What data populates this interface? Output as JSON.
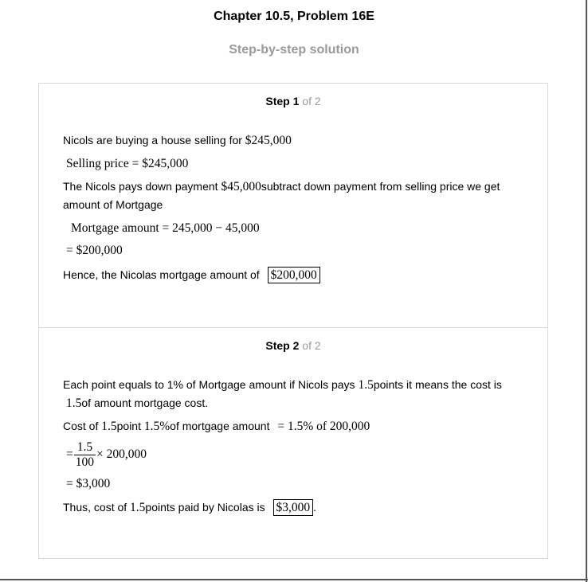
{
  "header": {
    "title": "Chapter 10.5, Problem 16E",
    "subtitle": "Step-by-step solution"
  },
  "steps": [
    {
      "label": "Step",
      "number": "1",
      "of_text": "of 2",
      "lines": {
        "l1_text": "Nicols are buying a house selling for",
        "l1_math": "$245,000",
        "l2_math": "Selling price = $245,000",
        "l3_text_a": "The Nicols pays down payment",
        "l3_math": "$45,000",
        "l3_text_b": "subtract down payment from selling price we get",
        "l4_text": "amount of Mortgage",
        "l5_math": "Mortgage amount = 245,000 − 45,000",
        "l6_math": "= $200,000",
        "l7_text": "Hence, the Nicolas mortgage amount of",
        "l7_boxed": "$200,000"
      }
    },
    {
      "label": "Step",
      "number": "2",
      "of_text": "of 2",
      "lines": {
        "l1_text_a": "Each point equals to 1% of Mortgage amount if Nicols pays",
        "l1_math": "1.5",
        "l1_text_b": "points it means the cost is",
        "l2_math": "1.5",
        "l2_text": "of amount mortgage cost.",
        "l3_text_a": "Cost of",
        "l3_math_a": "1.5",
        "l3_text_b": "point",
        "l3_math_b": "1.5%",
        "l3_text_c": "of mortgage amount",
        "l3_math_c": "= 1.5% of 200,000",
        "l4_eq": "=",
        "l4_num": "1.5",
        "l4_den": "100",
        "l4_rest": "× 200,000",
        "l5_math": "= $3,000",
        "l6_text_a": "Thus, cost of",
        "l6_math": "1.5",
        "l6_text_b": "points paid by Nicolas is",
        "l6_boxed": "$3,000",
        "l6_period": "."
      }
    }
  ]
}
